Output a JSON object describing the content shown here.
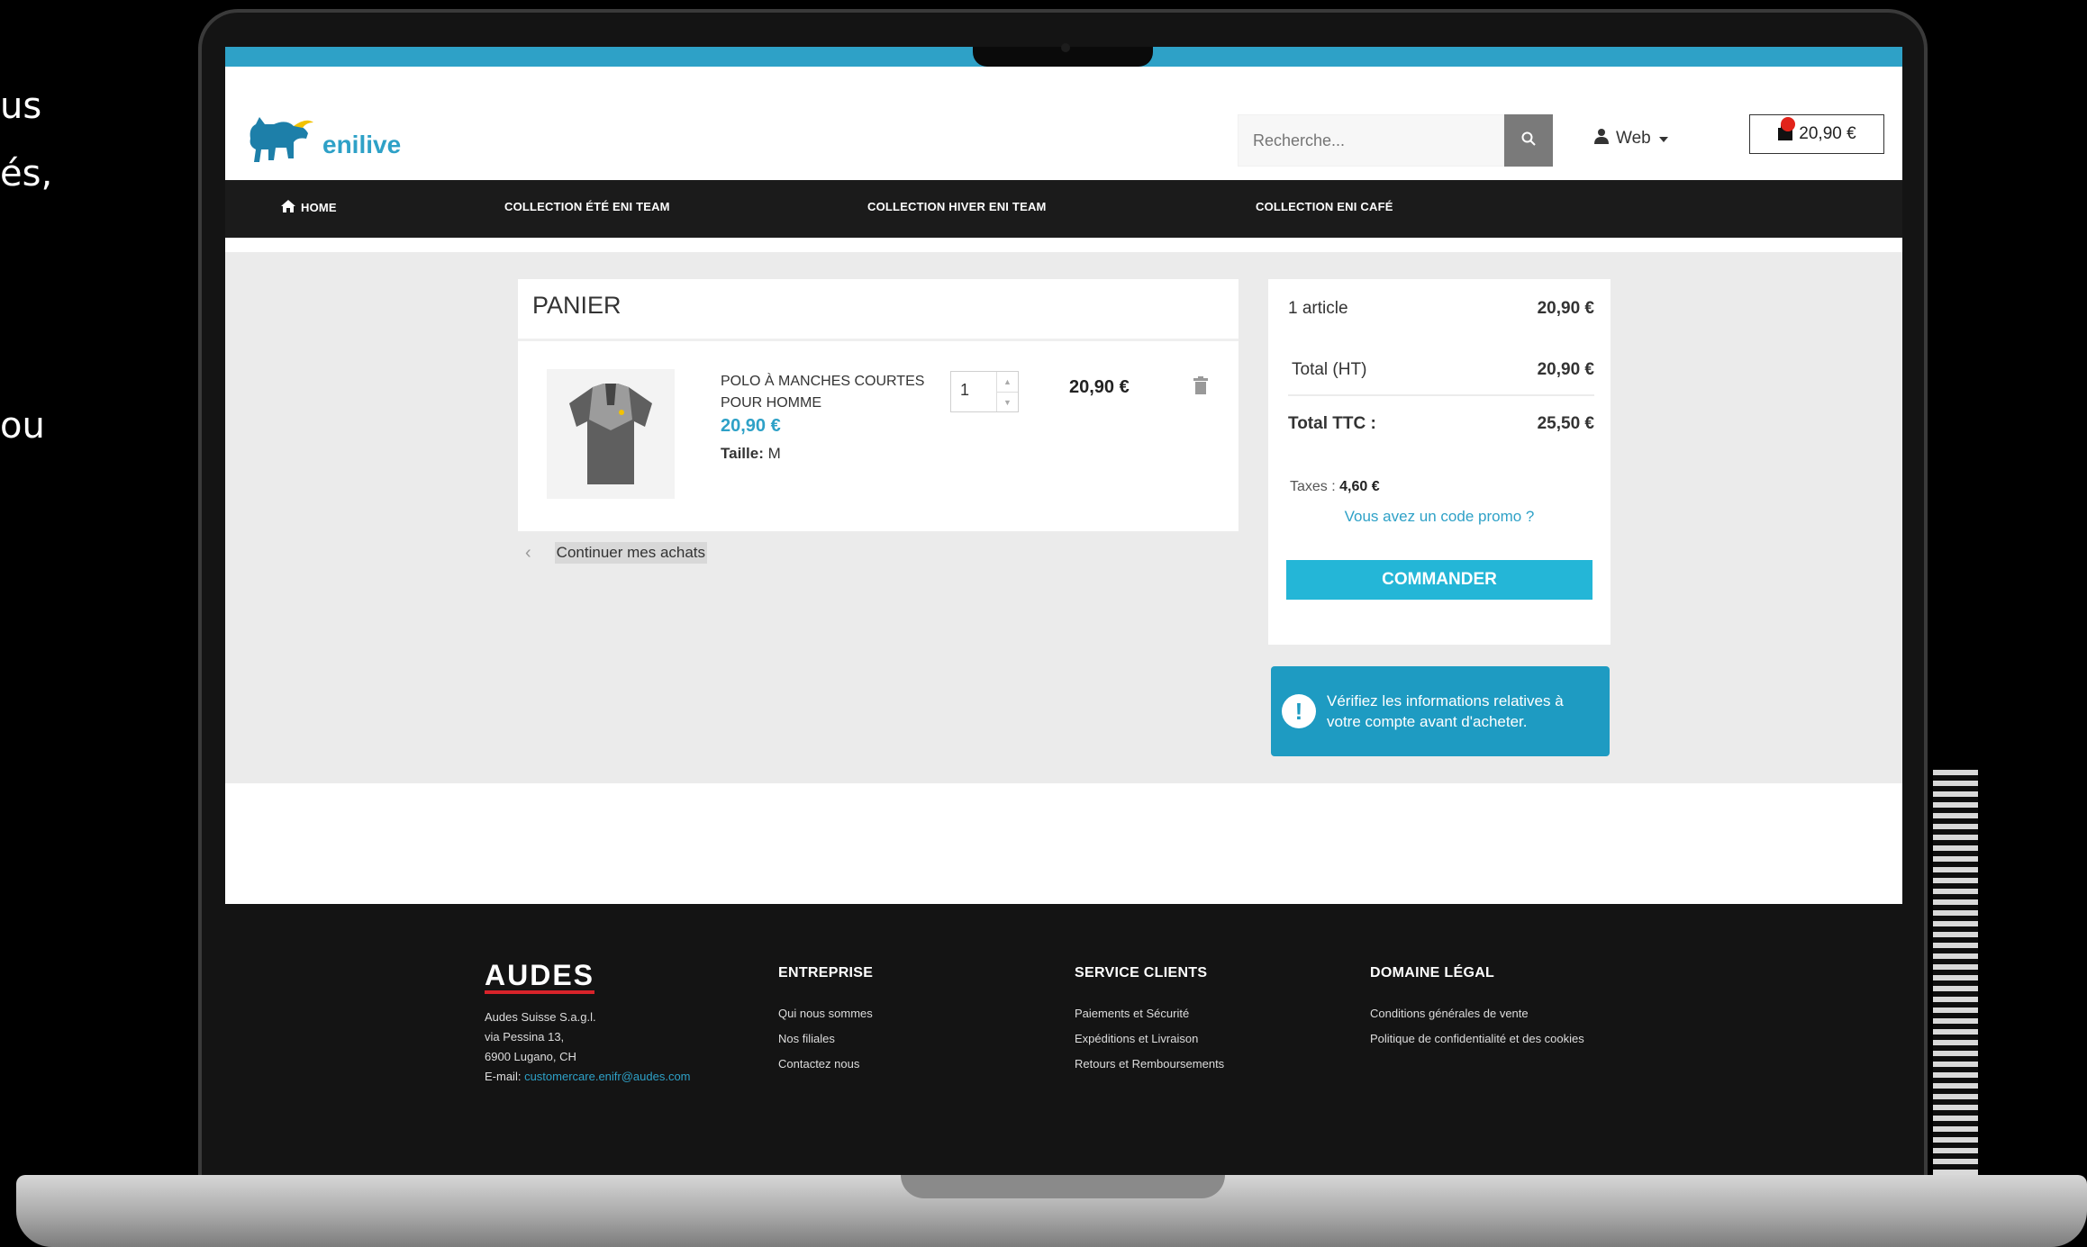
{
  "side_text": [
    "us",
    "és,",
    "ou"
  ],
  "site": {
    "logo_text": "enilive",
    "search_placeholder": "Recherche...",
    "account_label": "Web",
    "cart_total": "20,90 €"
  },
  "nav": {
    "home": "HOME",
    "items": [
      "COLLECTION ÉTÉ ENI TEAM",
      "COLLECTION HIVER ENI TEAM",
      "COLLECTION ENI CAFÉ"
    ]
  },
  "cart": {
    "title": "PANIER",
    "item": {
      "name": "POLO À MANCHES COURTES POUR HOMME",
      "price": "20,90 €",
      "size_label": "Taille:",
      "size_value": "M",
      "quantity": "1",
      "line_total": "20,90 €"
    },
    "continue_label": "Continuer mes achats"
  },
  "summary": {
    "articles_label": "1 article",
    "articles_value": "20,90 €",
    "total_ht_label": "Total (HT)",
    "total_ht_value": "20,90 €",
    "total_ttc_label": "Total TTC :",
    "total_ttc_value": "25,50 €",
    "taxes_label": "Taxes :",
    "taxes_value": "4,60 €",
    "promo_link": "Vous avez un code promo ?",
    "order_button": "COMMANDER"
  },
  "alert": {
    "message": "Vérifiez les informations relatives à votre compte avant d'acheter."
  },
  "footer": {
    "brand": "AUDES",
    "company_lines": [
      "Audes Suisse S.a.g.l.",
      "via Pessina 13,",
      "6900 Lugano, CH"
    ],
    "email_label": "E-mail:",
    "email_value": "customercare.enifr@audes.com",
    "col_entreprise": {
      "title": "ENTREPRISE",
      "links": [
        "Qui nous sommes",
        "Nos filiales",
        "Contactez nous"
      ]
    },
    "col_service": {
      "title": "SERVICE CLIENTS",
      "links": [
        "Paiements et Sécurité",
        "Expéditions et Livraison",
        "Retours et Remboursements"
      ]
    },
    "col_legal": {
      "title": "DOMAINE LÉGAL",
      "links": [
        "Conditions générales de vente",
        "Politique de confidentialité et des cookies"
      ]
    }
  },
  "colors": {
    "accent": "#2ea1c7",
    "button": "#24b6d7",
    "alert": "#1e9bc2",
    "nav": "#1b1b1b"
  }
}
